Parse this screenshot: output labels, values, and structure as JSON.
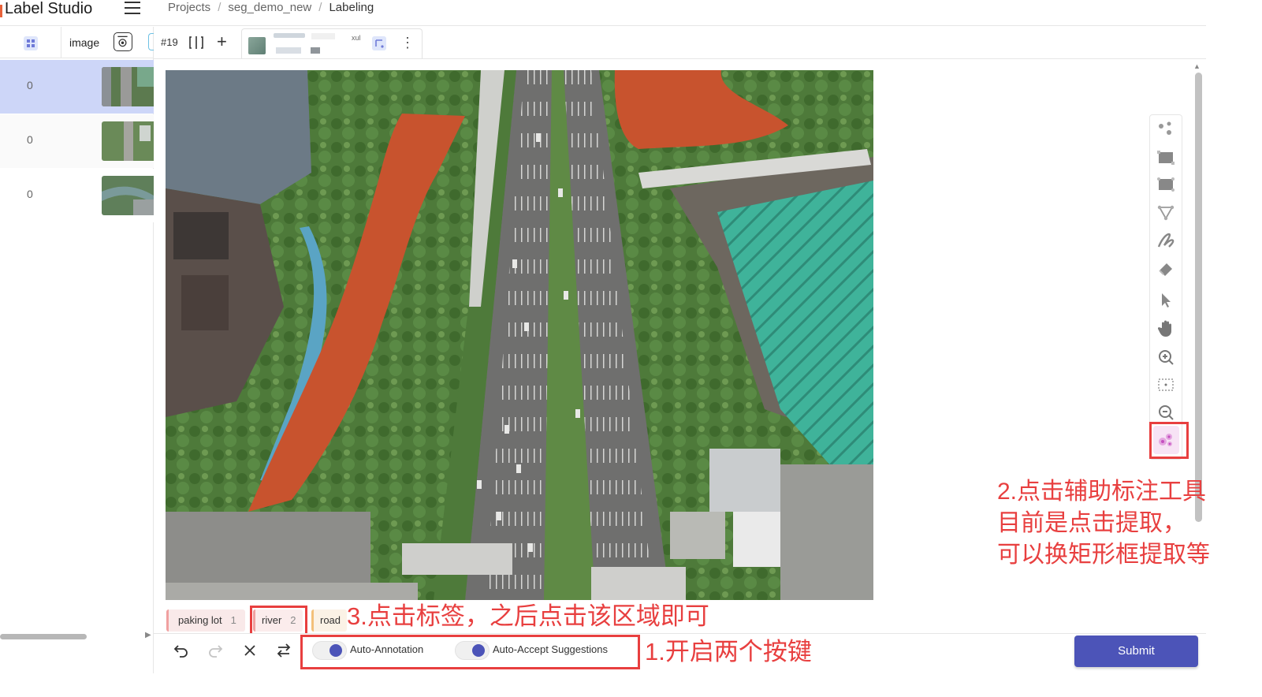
{
  "app": {
    "title": "Label Studio"
  },
  "breadcrumb": [
    "Projects",
    "seg_demo_new",
    "Labeling"
  ],
  "left_panel": {
    "column_image": "image",
    "rows": [
      {
        "count": "0",
        "selected": true
      },
      {
        "count": "0",
        "selected": false
      },
      {
        "count": "0",
        "selected": false
      }
    ]
  },
  "toolbar": {
    "task_id": "#19",
    "annotation_user_fragment": "xul"
  },
  "labels": [
    {
      "name": "paking lot",
      "key": "1",
      "color": "#f0a0a0"
    },
    {
      "name": "river",
      "key": "2",
      "color": "#f0a0a0"
    },
    {
      "name": "road",
      "key": "3",
      "color": "#f3c07a"
    }
  ],
  "bottom_bar": {
    "auto_annotation_label": "Auto-Annotation",
    "auto_accept_label": "Auto-Accept Suggestions",
    "submit_label": "Submit"
  },
  "tools": [
    "magic-points-icon",
    "rectangle-icon",
    "rectangle-3point-icon",
    "polygon-icon",
    "brush-icon",
    "eraser-icon",
    "select-pointer-icon",
    "pan-hand-icon",
    "zoom-in-icon",
    "fit-zoom-icon",
    "zoom-out-icon",
    "smart-keypoint-icon"
  ],
  "annotations": {
    "step1": "1.开启两个按键",
    "step2_lines": [
      "2.点击辅助标注工具",
      "目前是点击提取，",
      "可以换矩形框提取等"
    ],
    "step3": "3.点击标签，之后点击该区域即可"
  },
  "colors": {
    "accent": "#4c54b8",
    "annotation_red": "#e83f3f",
    "river_mask": "#c8532e",
    "selected_row": "#cdd6f8"
  }
}
